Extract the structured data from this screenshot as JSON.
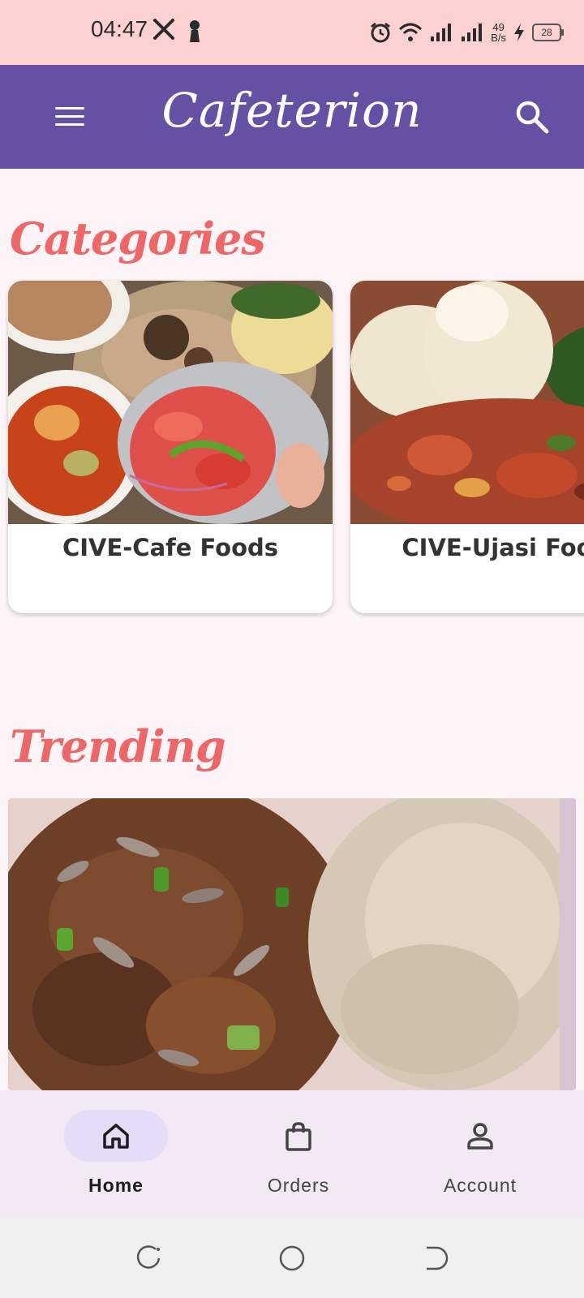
{
  "status_bar": {
    "time": "04:47",
    "net_speed_value": "49",
    "net_speed_unit": "B/s",
    "battery": "28",
    "icons": [
      "x-logo-icon",
      "person-icon",
      "alarm-icon",
      "wifi-icon",
      "signal-icon",
      "signal-icon",
      "charging-icon",
      "battery-icon"
    ]
  },
  "app_bar": {
    "title": "Cafeterion",
    "menu_icon": "hamburger-menu-icon",
    "search_icon": "search-icon",
    "background": "#6650a4"
  },
  "categories": {
    "title": "Categories",
    "items": [
      {
        "label": "CIVE-Cafe Foods",
        "image": "pilau-rice-plate-photo"
      },
      {
        "label": "CIVE-Ujasi Foods",
        "image": "ugali-stew-plate-photo"
      }
    ]
  },
  "trending": {
    "title": "Trending",
    "image": "fried-fish-ugali-photo"
  },
  "bottom_nav": {
    "items": [
      {
        "label": "Home",
        "icon": "home-icon",
        "active": true
      },
      {
        "label": "Orders",
        "icon": "shopping-bag-icon",
        "active": false
      },
      {
        "label": "Account",
        "icon": "account-icon",
        "active": false
      }
    ]
  },
  "colors": {
    "status_bar": "#fcd1d2",
    "accent_title": "#f06666",
    "page_background": "#fdf4f7",
    "nav_background": "#f2e9f5",
    "nav_active_pill": "#e6dcf7"
  }
}
